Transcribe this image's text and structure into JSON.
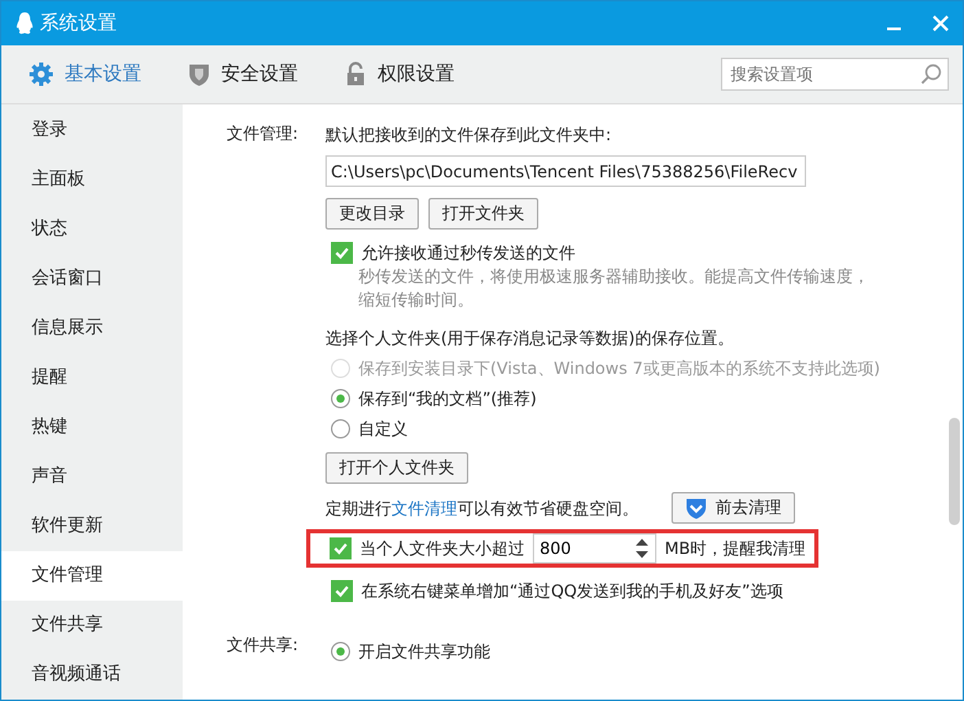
{
  "window": {
    "title": "系统设置"
  },
  "tabs": [
    {
      "label": "基本设置",
      "selected": true
    },
    {
      "label": "安全设置",
      "selected": false
    },
    {
      "label": "权限设置",
      "selected": false
    }
  ],
  "search": {
    "placeholder": "搜索设置项"
  },
  "sidebar": {
    "items": [
      {
        "label": "登录",
        "selected": false
      },
      {
        "label": "主面板",
        "selected": false
      },
      {
        "label": "状态",
        "selected": false
      },
      {
        "label": "会话窗口",
        "selected": false
      },
      {
        "label": "信息展示",
        "selected": false
      },
      {
        "label": "提醒",
        "selected": false
      },
      {
        "label": "热键",
        "selected": false
      },
      {
        "label": "声音",
        "selected": false
      },
      {
        "label": "软件更新",
        "selected": false
      },
      {
        "label": "文件管理",
        "selected": true
      },
      {
        "label": "文件共享",
        "selected": false
      },
      {
        "label": "音视频通话",
        "selected": false
      }
    ]
  },
  "file_management": {
    "label": "文件管理:",
    "intro": "默认把接收到的文件保存到此文件夹中:",
    "path": "C:\\Users\\pc\\Documents\\Tencent Files\\75388256\\FileRecv",
    "buttons": [
      "更改目录",
      "打开文件夹"
    ],
    "fast_transfer": {
      "label": "允许接收通过秒传发送的文件",
      "checked": true,
      "description": "秒传发送的文件，将使用极速服务器辅助接收。能提高文件传输速度，缩短传输时间。"
    },
    "personal_folder": {
      "prompt": "选择个人文件夹(用于保存消息记录等数据)的保存位置。",
      "options": [
        {
          "label": "保存到安装目录下(Vista、Windows 7或更高版本的系统不支持此选项)",
          "selected": false,
          "disabled": true
        },
        {
          "label": "保存到“我的文档”(推荐)",
          "selected": true,
          "disabled": false
        },
        {
          "label": "自定义",
          "selected": false,
          "disabled": false
        }
      ],
      "button": "打开个人文件夹"
    },
    "cleanup": {
      "text_before": "定期进行",
      "link": "文件清理",
      "text_after": "可以有效节省硬盘空间。",
      "button": "前去清理"
    },
    "size_alert": {
      "checked": true,
      "label_before": "当个人文件夹大小超过",
      "value": "800",
      "label_after": "MB时，提醒我清理",
      "highlighted": true
    },
    "context_menu": {
      "checked": true,
      "label": "在系统右键菜单增加“通过QQ发送到我的手机及好友”选项"
    }
  },
  "file_sharing": {
    "label": "文件共享:",
    "options": [
      {
        "label": "开启文件共享功能",
        "selected": true,
        "disabled": false
      }
    ]
  }
}
